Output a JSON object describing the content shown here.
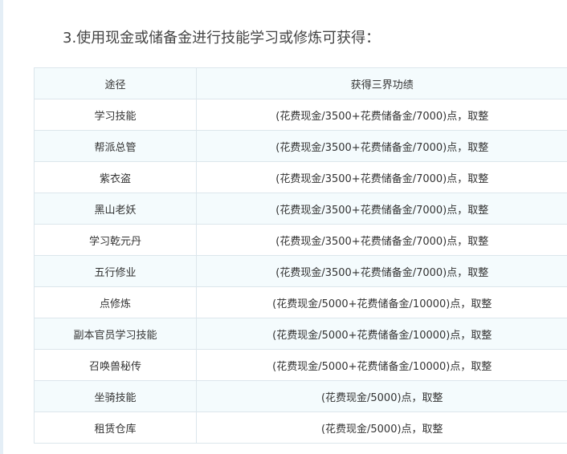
{
  "heading": "3.使用现金或储备金进行技能学习或修炼可获得：",
  "table": {
    "headers": [
      "途径",
      "获得三界功绩"
    ],
    "rows": [
      {
        "route": "学习技能",
        "gain": "(花费现金/3500+花费储备金/7000)点，取整"
      },
      {
        "route": "帮派总管",
        "gain": "(花费现金/3500+花费储备金/7000)点，取整"
      },
      {
        "route": "紫衣盗",
        "gain": "(花费现金/3500+花费储备金/7000)点，取整"
      },
      {
        "route": "黑山老妖",
        "gain": "(花费现金/3500+花费储备金/7000)点，取整"
      },
      {
        "route": "学习乾元丹",
        "gain": "(花费现金/3500+花费储备金/7000)点，取整"
      },
      {
        "route": "五行修业",
        "gain": "(花费现金/3500+花费储备金/7000)点，取整"
      },
      {
        "route": "点修炼",
        "gain": "(花费现金/5000+花费储备金/10000)点，取整"
      },
      {
        "route": "副本官员学习技能",
        "gain": "(花费现金/5000+花费储备金/10000)点，取整"
      },
      {
        "route": "召唤兽秘传",
        "gain": "(花费现金/5000+花费储备金/10000)点，取整"
      },
      {
        "route": "坐骑技能",
        "gain": "(花费现金/5000)点，取整"
      },
      {
        "route": "租赁仓库",
        "gain": "(花费现金/5000)点，取整"
      }
    ]
  }
}
